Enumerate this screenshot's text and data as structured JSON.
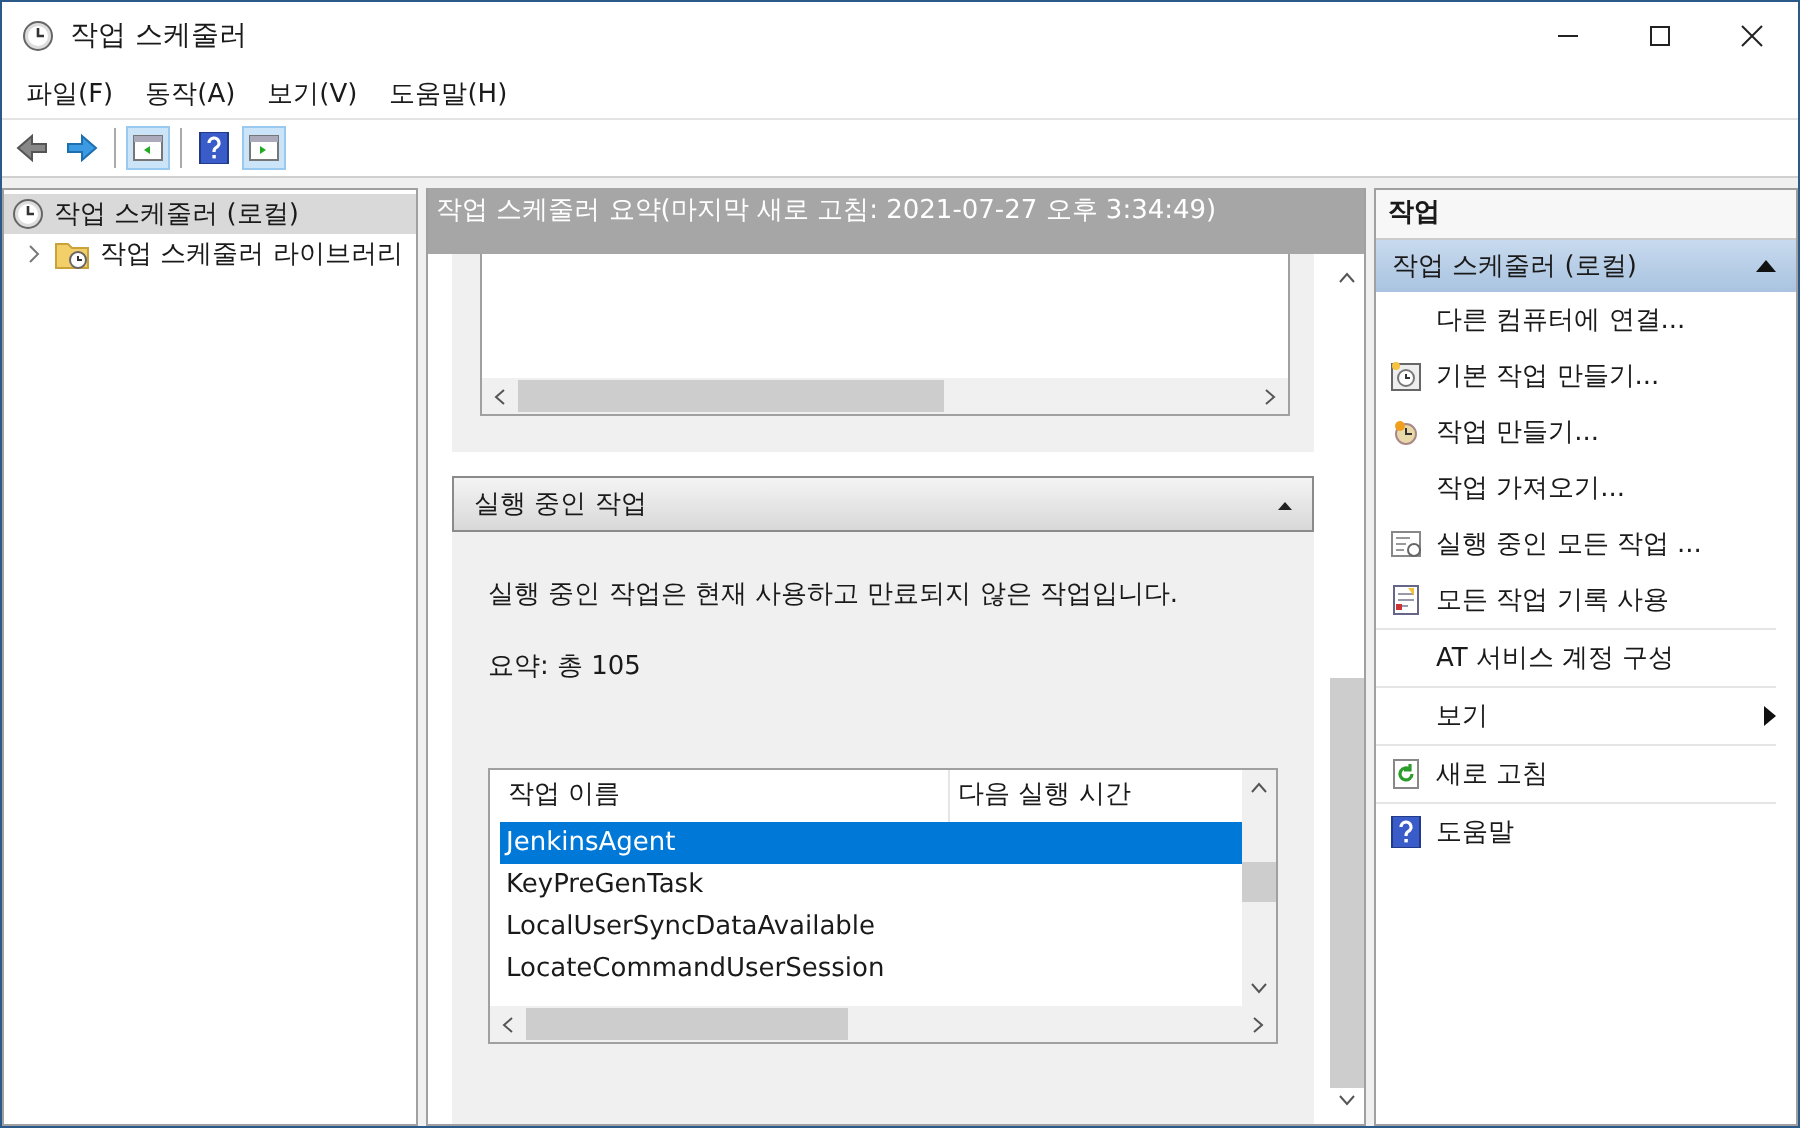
{
  "window": {
    "title": "작업 스케줄러"
  },
  "menu": [
    "파일(F)",
    "동작(A)",
    "보기(V)",
    "도움말(H)"
  ],
  "toolbar": [
    {
      "kind": "back",
      "pressed": false
    },
    {
      "kind": "forward",
      "pressed": false
    },
    {
      "kind": "sep"
    },
    {
      "kind": "pane-left",
      "pressed": true
    },
    {
      "kind": "sep"
    },
    {
      "kind": "help",
      "pressed": false
    },
    {
      "kind": "pane-right",
      "pressed": true
    }
  ],
  "tree": [
    {
      "label": "작업 스케줄러 (로컬)",
      "selected": true,
      "children": [
        {
          "label": "작업 스케줄러 라이브러리",
          "selected": false,
          "expanded": false
        }
      ]
    }
  ],
  "summary": {
    "title": "작업 스케줄러 요약(마지막 새로 고침: 2021-07-27 오후 3:34:49)",
    "section": {
      "title": "실행 중인 작업",
      "expanded": true,
      "description": "실행 중인 작업은 현재 사용하고 만료되지 않은 작업입니다.",
      "total": "요약: 총 105",
      "columns": [
        "작업 이름",
        "다음 실행 시간"
      ],
      "rows": [
        {
          "name": "JenkinsAgent",
          "selected": true
        },
        {
          "name": "KeyPreGenTask",
          "selected": false
        },
        {
          "name": "LocalUserSyncDataAvailable",
          "selected": false
        },
        {
          "name": "LocateCommandUserSession",
          "selected": false
        }
      ]
    }
  },
  "actions": {
    "title": "작업",
    "group": {
      "title": "작업 스케줄러 (로컬)",
      "expanded": true
    },
    "items": [
      {
        "label": "다른 컴퓨터에 연결...",
        "kind": "plain",
        "divider_after": false
      },
      {
        "label": "기본 작업 만들기...",
        "kind": "calendar",
        "divider_after": false
      },
      {
        "label": "작업 만들기...",
        "kind": "clock",
        "divider_after": false
      },
      {
        "label": "작업 가져오기...",
        "kind": "plain",
        "divider_after": false
      },
      {
        "label": "실행 중인 모든 작업 ...",
        "kind": "list",
        "divider_after": false
      },
      {
        "label": "모든 작업 기록 사용",
        "kind": "log",
        "divider_after": true
      },
      {
        "label": "AT 서비스 계정 구성",
        "kind": "plain",
        "divider_after": true
      },
      {
        "label": "보기",
        "kind": "submenu",
        "divider_after": true
      },
      {
        "label": "새로 고침",
        "kind": "refresh",
        "divider_after": true
      },
      {
        "label": "도움말",
        "kind": "help",
        "divider_after": false
      }
    ]
  }
}
